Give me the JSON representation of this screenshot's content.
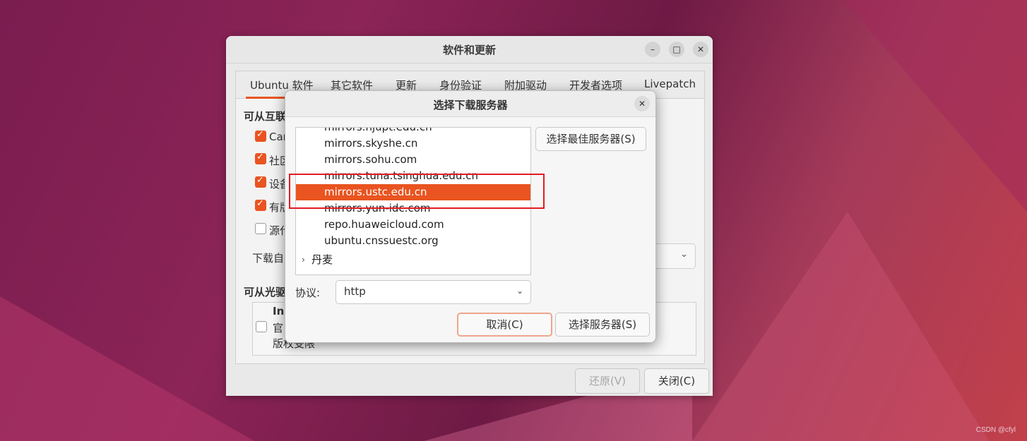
{
  "main_window": {
    "title": "软件和更新",
    "controls": {
      "minimize": "–",
      "maximize": "□",
      "close": "✕"
    },
    "tabs": [
      {
        "label": "Ubuntu 软件",
        "active": true
      },
      {
        "label": "其它软件"
      },
      {
        "label": "更新"
      },
      {
        "label": "身份验证"
      },
      {
        "label": "附加驱动"
      },
      {
        "label": "开发者选项"
      },
      {
        "label": "Livepatch"
      }
    ],
    "internet_section_title": "可从互联",
    "checkboxes": [
      {
        "label": "Car",
        "checked": true
      },
      {
        "label": "社区",
        "checked": true
      },
      {
        "label": "设备",
        "checked": true
      },
      {
        "label": "有版",
        "checked": true
      },
      {
        "label": "源代",
        "checked": false
      }
    ],
    "download_from_label": "下载自",
    "cdrom_section_title": "可从光驱",
    "cdrom_item": {
      "line1": "Ins",
      "line2": "官",
      "line3": "版权受限",
      "checked": false
    },
    "buttons": {
      "revert": "还原(V)",
      "close": "关闭(C)"
    }
  },
  "dialog": {
    "title": "选择下载服务器",
    "close_icon": "✕",
    "servers": [
      "mirrors.njupt.edu.cn",
      "mirrors.skyshe.cn",
      "mirrors.sohu.com",
      "mirrors.tuna.tsinghua.edu.cn",
      "mirrors.ustc.edu.cn",
      "mirrors.yun-idc.com",
      "repo.huaweicloud.com",
      "ubuntu.cnssuestc.org"
    ],
    "selected_server": "mirrors.ustc.edu.cn",
    "group": "丹麦",
    "best_server_button": "选择最佳服务器(S)",
    "protocol_label": "协议:",
    "protocol_value": "http",
    "cancel_button": "取消(C)",
    "choose_button": "选择服务器(S)"
  },
  "watermark": "CSDN @cfyl",
  "colors": {
    "accent": "#e95420",
    "highlight_box": "#e21b25"
  }
}
